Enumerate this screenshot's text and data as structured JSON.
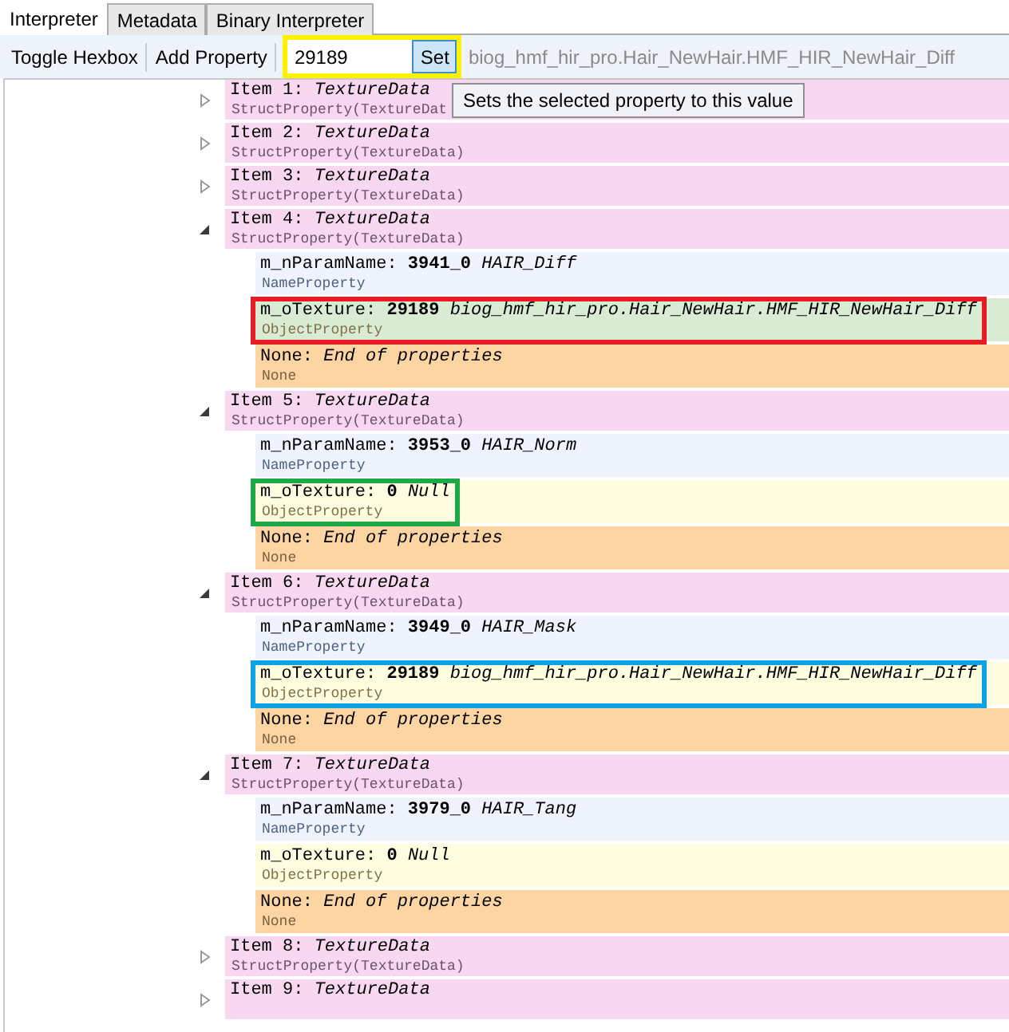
{
  "tabs": [
    {
      "label": "Interpreter",
      "selected": true
    },
    {
      "label": "Metadata",
      "selected": false
    },
    {
      "label": "Binary Interpreter",
      "selected": false
    }
  ],
  "toolbar": {
    "buttons": [
      "Toggle Hexbox",
      "Add Property"
    ],
    "value_field": {
      "value": "29189"
    },
    "set_button": "Set",
    "color": "#fff200",
    "value_preview": "biog_hmf_hir_pro.Hair_NewHair.HMF_HIR_NewHair_Diff"
  },
  "tooltip": "Sets the selected property to this value",
  "tree": [
    {
      "kind": "struct",
      "label": "Item 1: *TextureData*",
      "type": "StructProperty(TextureDat",
      "expanded": false,
      "selected": false
    },
    {
      "kind": "struct",
      "label": "Item 2: *TextureData*",
      "type": "StructProperty(TextureData)",
      "expanded": false,
      "selected": false
    },
    {
      "kind": "struct",
      "label": "Item 3: *TextureData*",
      "type": "StructProperty(TextureData)",
      "expanded": false,
      "selected": false
    },
    {
      "kind": "struct",
      "label": "Item 4: *TextureData*",
      "type": "StructProperty(TextureData)",
      "expanded": true,
      "selected": false,
      "children": [
        {
          "kind": "name",
          "label": "m_nParamName: **3941_0** *HAIR_Diff*",
          "type": "NameProperty",
          "selected": false
        },
        {
          "kind": "object",
          "label": "m_oTexture: **29189** *biog_hmf_hir_pro.Hair_NewHair.HMF_HIR_NewHair_Diff*",
          "type": "ObjectProperty",
          "selected": true,
          "color": "#e81c24"
        },
        {
          "kind": "none",
          "label": "None: *End of properties*",
          "type": "None",
          "selected": false
        }
      ]
    },
    {
      "kind": "struct",
      "label": "Item 5: *TextureData*",
      "type": "StructProperty(TextureData)",
      "expanded": true,
      "selected": false,
      "children": [
        {
          "kind": "name",
          "label": "m_nParamName: **3953_0** *HAIR_Norm*",
          "type": "NameProperty",
          "selected": false
        },
        {
          "kind": "object",
          "label": "m_oTexture: **0** *Null*",
          "type": "ObjectProperty",
          "selected": false,
          "color": "#1fa847"
        },
        {
          "kind": "none",
          "label": "None: *End of properties*",
          "type": "None",
          "selected": false
        }
      ]
    },
    {
      "kind": "struct",
      "label": "Item 6: *TextureData*",
      "type": "StructProperty(TextureData)",
      "expanded": true,
      "selected": false,
      "children": [
        {
          "kind": "name",
          "label": "m_nParamName: **3949_0** *HAIR_Mask*",
          "type": "NameProperty",
          "selected": false
        },
        {
          "kind": "object",
          "label": "m_oTexture: **29189** *biog_hmf_hir_pro.Hair_NewHair.HMF_HIR_NewHair_Diff*",
          "type": "ObjectProperty",
          "selected": false,
          "color": "#0ba3e3"
        },
        {
          "kind": "none",
          "label": "None: *End of properties*",
          "type": "None",
          "selected": false
        }
      ]
    },
    {
      "kind": "struct",
      "label": "Item 7: *TextureData*",
      "type": "StructProperty(TextureData)",
      "expanded": true,
      "selected": false,
      "children": [
        {
          "kind": "name",
          "label": "m_nParamName: **3979_0** *HAIR_Tang*",
          "type": "NameProperty",
          "selected": false
        },
        {
          "kind": "object",
          "label": "m_oTexture: **0** *Null*",
          "type": "ObjectProperty",
          "selected": false
        },
        {
          "kind": "none",
          "label": "None: *End of properties*",
          "type": "None",
          "selected": false
        }
      ]
    },
    {
      "kind": "struct",
      "label": "Item 8: *TextureData*",
      "type": "StructProperty(TextureData)",
      "expanded": false,
      "selected": false
    },
    {
      "kind": "struct",
      "label": "Item 9: *TextureData*",
      "expanded": false,
      "selected": false
    }
  ]
}
